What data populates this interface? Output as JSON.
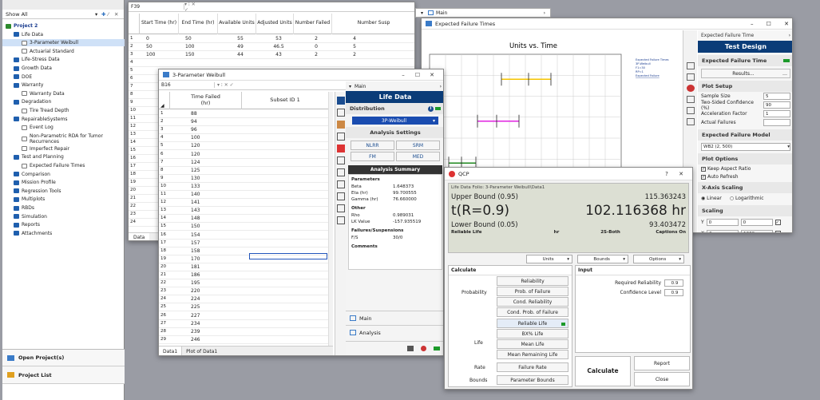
{
  "project_panel": {
    "show_filter": "Show All",
    "tree": [
      {
        "label": "Project 2",
        "level": 0,
        "bold": true,
        "icon": "project-icon"
      },
      {
        "label": "Life Data",
        "level": 1,
        "icon": "folder-icon"
      },
      {
        "label": "3-Parameter Weibull",
        "level": 2,
        "icon": "folio-icon",
        "selected": true
      },
      {
        "label": "Actuarial Standard",
        "level": 2,
        "icon": "folio-icon"
      },
      {
        "label": "Life-Stress Data",
        "level": 1,
        "icon": "folder-icon"
      },
      {
        "label": "Growth Data",
        "level": 1,
        "icon": "folder-icon"
      },
      {
        "label": "DOE",
        "level": 1,
        "icon": "folder-icon"
      },
      {
        "label": "Warranty",
        "level": 1,
        "icon": "folder-icon"
      },
      {
        "label": "Warranty Data",
        "level": 2,
        "icon": "folio-icon"
      },
      {
        "label": "Degradation",
        "level": 1,
        "icon": "folder-icon"
      },
      {
        "label": "Tire Tread Depth",
        "level": 2,
        "icon": "folio-icon"
      },
      {
        "label": "RepairableSystems",
        "level": 1,
        "icon": "folder-icon"
      },
      {
        "label": "Event Log",
        "level": 2,
        "icon": "folio-icon"
      },
      {
        "label": "Non-Parametric RDA for Tumor Recurrences",
        "level": 2,
        "icon": "folio-icon"
      },
      {
        "label": "Imperfect Repair",
        "level": 2,
        "icon": "folio-icon"
      },
      {
        "label": "Test and Planning",
        "level": 1,
        "icon": "folder-icon"
      },
      {
        "label": "Expected Failure Times",
        "level": 2,
        "icon": "folio-icon"
      },
      {
        "label": "Comparison",
        "level": 1,
        "icon": "folder-icon"
      },
      {
        "label": "Mission Profile",
        "level": 1,
        "icon": "folder-icon"
      },
      {
        "label": "Regression Tools",
        "level": 1,
        "icon": "folder-icon"
      },
      {
        "label": "Multiplots",
        "level": 1,
        "icon": "folder-icon"
      },
      {
        "label": "RBDs",
        "level": 1,
        "icon": "folder-icon"
      },
      {
        "label": "Simulation",
        "level": 1,
        "icon": "folder-icon"
      },
      {
        "label": "Reports",
        "level": 1,
        "icon": "folder-icon"
      },
      {
        "label": "Attachments",
        "level": 1,
        "icon": "folder-icon"
      }
    ],
    "open_projects": "Open Project(s)",
    "project_list": "Project List"
  },
  "back_sheet": {
    "cell_ref": "F39",
    "headers": [
      "Start Time (hr)",
      "End Time (hr)",
      "Available Units",
      "Adjusted Units",
      "Number Failed",
      "Number Susp"
    ],
    "rows": [
      [
        "0",
        "50",
        "55",
        "53",
        "2",
        "4"
      ],
      [
        "50",
        "100",
        "49",
        "46.5",
        "0",
        "5"
      ],
      [
        "100",
        "150",
        "44",
        "43",
        "2",
        "2"
      ]
    ],
    "row_numbers": [
      "1",
      "2",
      "3",
      "4",
      "5",
      "6",
      "7",
      "8",
      "9",
      "10",
      "11",
      "12",
      "13",
      "14",
      "15",
      "16",
      "17",
      "18",
      "19",
      "20",
      "21",
      "22",
      "23",
      "24"
    ],
    "tab": "Data"
  },
  "weibull": {
    "title": "3-Parameter Weibull",
    "cell_ref": "B16",
    "headers": [
      "Time Failed (hr)",
      "Subset ID 1"
    ],
    "values": [
      "88",
      "94",
      "96",
      "100",
      "120",
      "120",
      "124",
      "125",
      "130",
      "133",
      "140",
      "141",
      "143",
      "148",
      "150",
      "154",
      "157",
      "158",
      "170",
      "181",
      "186",
      "195",
      "220",
      "224",
      "225",
      "227",
      "234",
      "239",
      "246"
    ],
    "tabs": [
      "Data1",
      "Plot of Data1"
    ],
    "main_label": "Main",
    "life_data": "Life Data",
    "distribution_label": "Distribution",
    "distribution_value": "3P-Weibull",
    "analysis_settings": "Analysis Settings",
    "settings": [
      "NLRR",
      "SRM",
      "FM",
      "MED"
    ],
    "analysis_summary": "Analysis Summary",
    "parameters_label": "Parameters",
    "params": [
      [
        "Beta",
        "1.648373"
      ],
      [
        "Eta (hr)",
        "99.700555"
      ],
      [
        "Gamma (hr)",
        "76.660000"
      ]
    ],
    "other_label": "Other",
    "other": [
      [
        "Rho",
        "0.989031"
      ],
      [
        "LK Value",
        "-157.935519"
      ]
    ],
    "fs_label": "Failures/Suspensions",
    "fs": [
      [
        "F/S",
        "30/0"
      ]
    ],
    "comments": "Comments",
    "bottom_main": "Main",
    "bottom_analysis": "Analysis"
  },
  "main_header": {
    "main1": "Main",
    "main2": "Main"
  },
  "eft": {
    "title": "Expected Failure Times",
    "chart_title": "Units vs. Time",
    "legend": [
      "Expected Failure Times",
      "3P-Weibull",
      "F1=30",
      "RP=1",
      "Expected Failure"
    ],
    "panel_header": "Expected Failure Time",
    "test_design": "Test Design",
    "eft_section": "Expected Failure Time",
    "results_btn": "Results...",
    "plot_setup": "Plot Setup",
    "setup": [
      [
        "Sample Size",
        "5"
      ],
      [
        "Two-Sided Confidence (%)",
        "90"
      ],
      [
        "Acceleration Factor",
        "1"
      ],
      [
        "Actual Failures",
        ""
      ]
    ],
    "model_section": "Expected Failure Model",
    "model_value": "WB2 (2, 500)",
    "plot_options": "Plot Options",
    "keep_aspect": "Keep Aspect Ratio",
    "auto_refresh": "Auto Refresh",
    "x_axis_scaling": "X-Axis Scaling",
    "linear": "Linear",
    "logarithmic": "Logarithmic",
    "scaling": "Scaling",
    "y_range": [
      "0",
      "0"
    ],
    "x_range": [
      "0",
      "1200"
    ]
  },
  "chart_data": {
    "type": "line",
    "title": "Units vs. Time",
    "series": [
      {
        "color": "#f5c400",
        "y": 1,
        "x": [
          450,
          620,
          760
        ]
      },
      {
        "color": "#e022e0",
        "y": 2,
        "x": [
          300,
          420,
          560
        ]
      },
      {
        "color": "#1f8a1f",
        "y": 3,
        "x": [
          120,
          200,
          290
        ]
      }
    ]
  },
  "qcp": {
    "title": "QCP",
    "folio": "Life Data Folio: 3-Parameter Weibull\\Data1",
    "upper_label": "Upper Bound (0.95)",
    "upper_value": "115.363243",
    "main_label": "t(R=0.9)",
    "main_value": "102.116368 hr",
    "lower_label": "Lower Bound (0.05)",
    "lower_value": "93.403472",
    "reliable_life": "Reliable Life",
    "hr": "hr",
    "two_sided": "2S-Both",
    "captions_on": "Captions On",
    "units": "Units",
    "bounds": "Bounds",
    "options": "Options",
    "calculate_section": "Calculate",
    "input_section": "Input",
    "probability": "Probability",
    "prob_buttons": [
      "Reliability",
      "Prob. of Failure",
      "Cond. Reliability",
      "Cond. Prob. of Failure"
    ],
    "life": "Life",
    "life_buttons": [
      "Reliable Life",
      "BX% Life",
      "Mean Life",
      "Mean Remaining Life"
    ],
    "rate": "Rate",
    "rate_button": "Failure Rate",
    "bounds_label": "Bounds",
    "bounds_button": "Parameter Bounds",
    "required_reliability": "Required Reliability",
    "required_reliability_value": "0.9",
    "confidence_level": "Confidence Level",
    "confidence_level_value": "0.9",
    "calculate_btn": "Calculate",
    "report_btn": "Report",
    "close_btn": "Close"
  }
}
